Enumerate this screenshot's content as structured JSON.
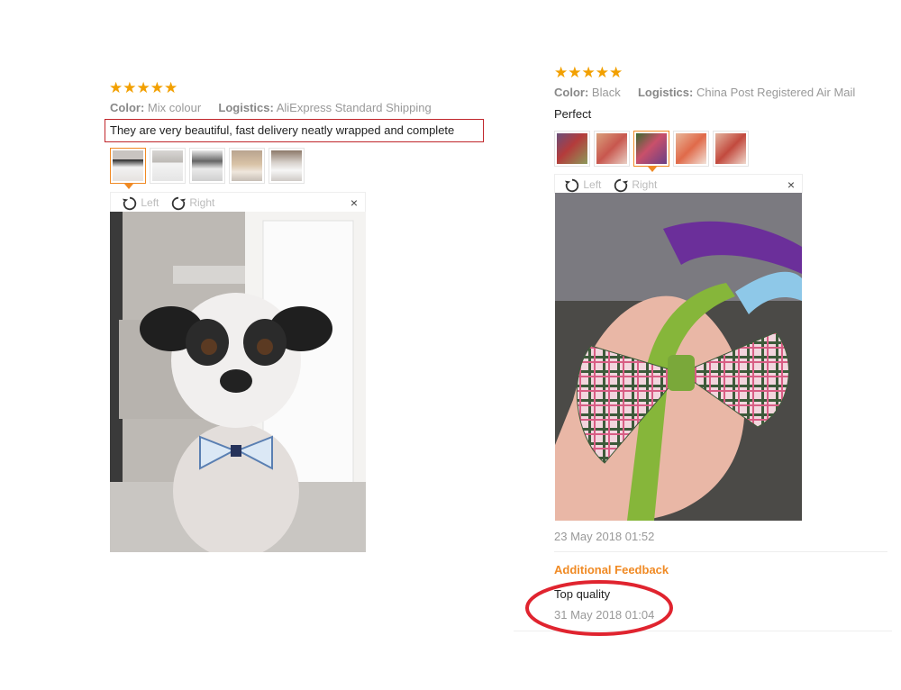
{
  "review_left": {
    "stars": "★★★★★",
    "color_label": "Color:",
    "color_value": "Mix colour",
    "logistics_label": "Logistics:",
    "logistics_value": "AliExpress Standard Shipping",
    "comment": "They are very beautiful, fast delivery neatly wrapped and complete",
    "thumbnail_count": 5,
    "viewer": {
      "rotate_left": "Left",
      "rotate_right": "Right",
      "close": "×"
    }
  },
  "review_right": {
    "stars": "★★★★★",
    "color_label": "Color:",
    "color_value": "Black",
    "logistics_label": "Logistics:",
    "logistics_value": "China Post Registered Air Mail",
    "comment": "Perfect",
    "thumbnail_count": 5,
    "viewer": {
      "rotate_left": "Left",
      "rotate_right": "Right",
      "close": "×"
    },
    "date": "23 May 2018 01:52",
    "additional_feedback": {
      "title": "Additional Feedback",
      "text": "Top quality",
      "date": "31 May 2018 01:04"
    }
  },
  "colors": {
    "star": "#f2a000",
    "accent": "#f08a24",
    "highlight_box": "#c0262b",
    "highlight_ellipse": "#e0242f"
  }
}
